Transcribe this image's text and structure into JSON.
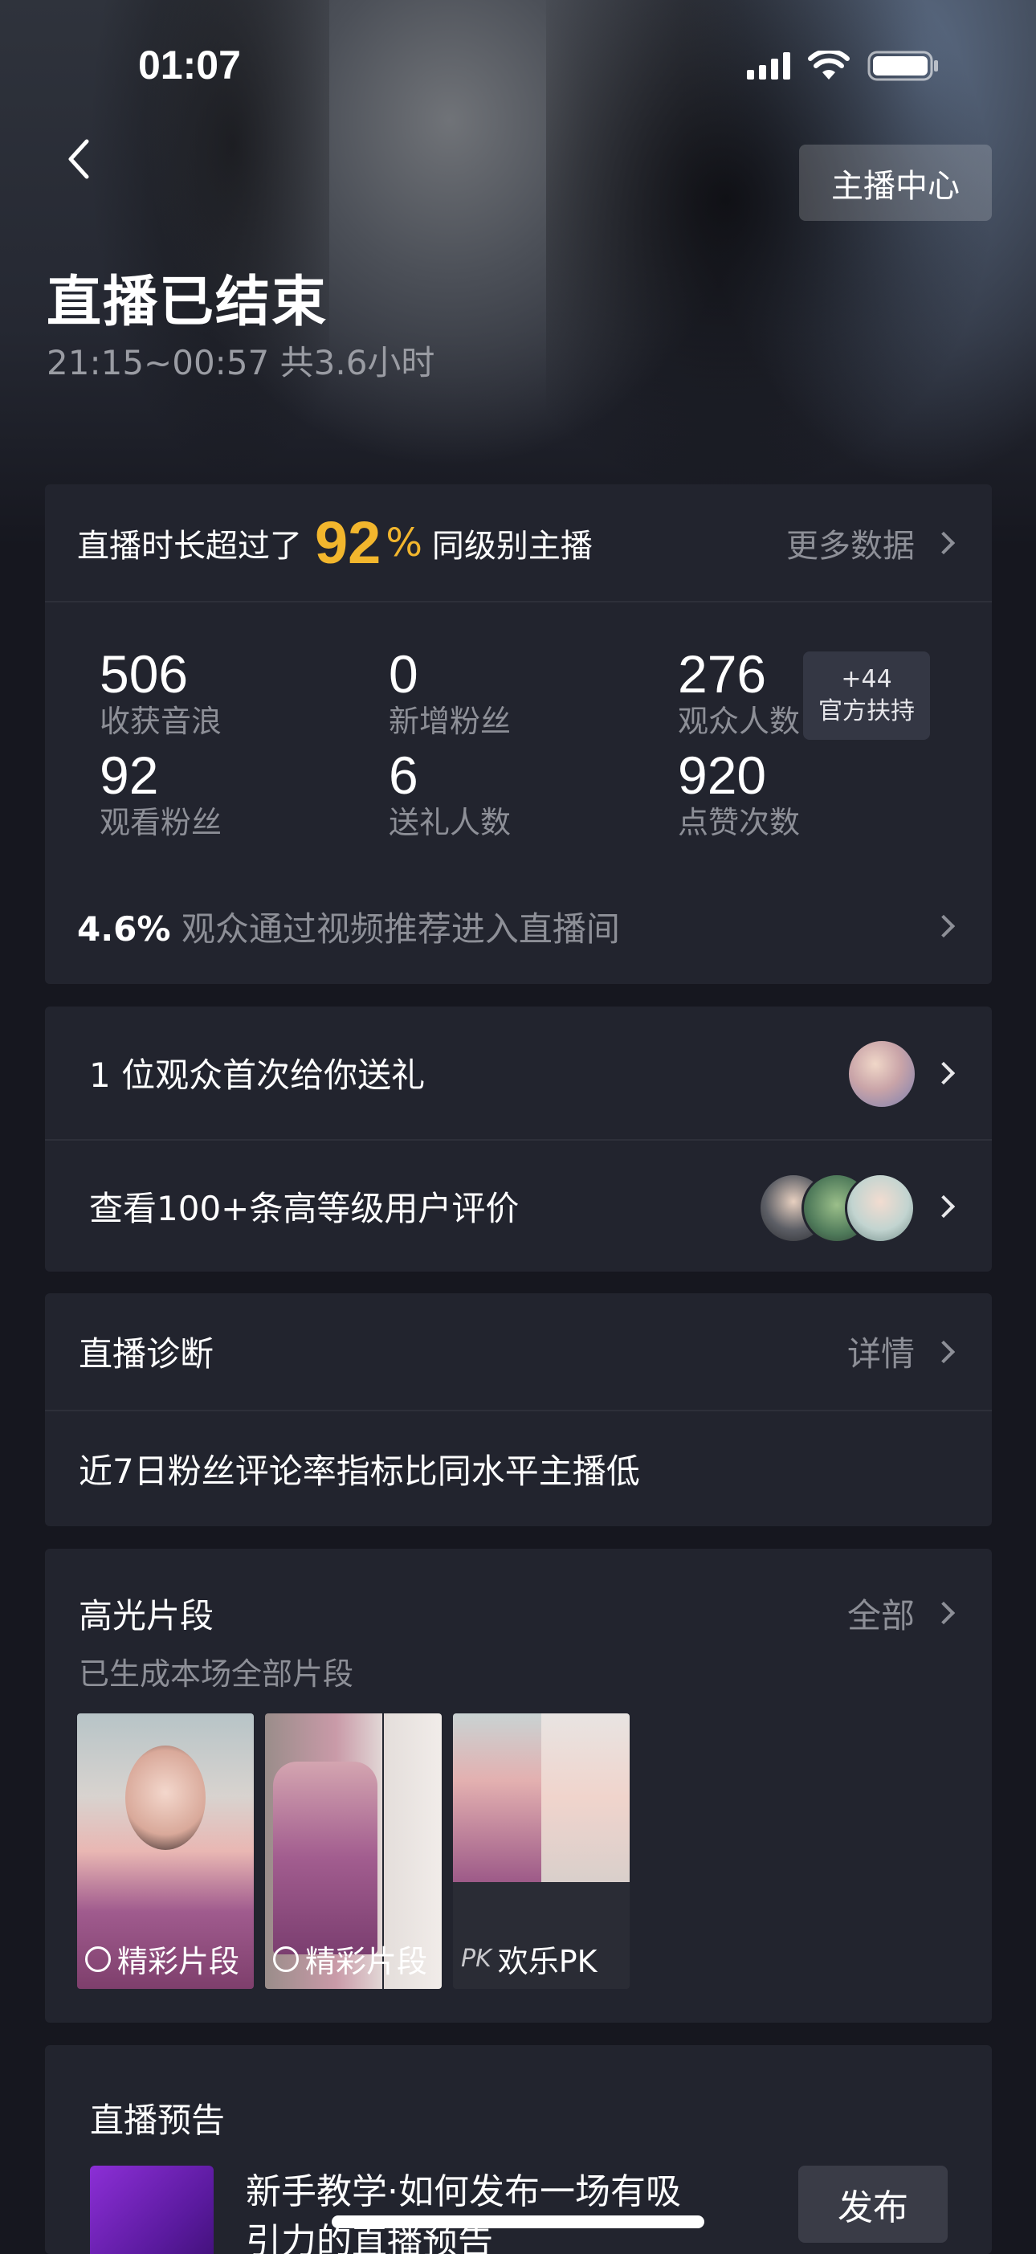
{
  "status_bar": {
    "time": "01:07"
  },
  "header": {
    "center_button": "主播中心",
    "title": "直播已结束",
    "subtitle": "21:15~00:57 共3.6小时"
  },
  "summary": {
    "prefix": "直播时长超过了",
    "percent": "92",
    "percent_sign": "%",
    "suffix": "同级别主播",
    "more": "更多数据",
    "stats": [
      {
        "value": "506",
        "label": "收获音浪"
      },
      {
        "value": "0",
        "label": "新增粉丝"
      },
      {
        "value": "276",
        "label": "观众人数"
      },
      {
        "value": "92",
        "label": "观看粉丝"
      },
      {
        "value": "6",
        "label": "送礼人数"
      },
      {
        "value": "920",
        "label": "点赞次数"
      }
    ],
    "boost": {
      "value": "+44",
      "label": "官方扶持"
    },
    "recommend_value": "4.6%",
    "recommend_text": "观众通过视频推荐进入直播间"
  },
  "gift_row": {
    "text": "1 位观众首次给你送礼"
  },
  "review_row": {
    "text": "查看100+条高等级用户评价"
  },
  "diagnosis": {
    "title": "直播诊断",
    "more": "详情",
    "message": "近7日粉丝评论率指标比同水平主播低"
  },
  "highlights": {
    "title": "高光片段",
    "more": "全部",
    "subtitle": "已生成本场全部片段",
    "clips": [
      {
        "label": "精彩片段"
      },
      {
        "label": "精彩片段"
      },
      {
        "label": "欢乐PK",
        "badge": "PK"
      }
    ]
  },
  "preview": {
    "title": "直播预告",
    "text_line1": "新手教学·如何发布一场有吸",
    "text_line2": "引力的直播预告",
    "button": "发布"
  },
  "colors": {
    "accent": "#f2b62d",
    "card": "#22242e",
    "background": "#16171f"
  }
}
